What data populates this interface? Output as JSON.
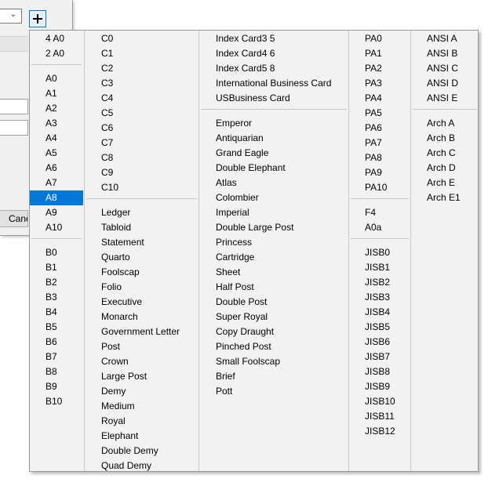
{
  "dialog": {
    "cancel_label": "Cancel"
  },
  "menu": {
    "selected": "A8",
    "columns": [
      {
        "groups": [
          [
            "4 A0",
            "2 A0"
          ],
          [
            "A0",
            "A1",
            "A2",
            "A3",
            "A4",
            "A5",
            "A6",
            "A7",
            "A8",
            "A9",
            "A10"
          ],
          [
            "B0",
            "B1",
            "B2",
            "B3",
            "B4",
            "B5",
            "B6",
            "B7",
            "B8",
            "B9",
            "B10"
          ]
        ]
      },
      {
        "groups": [
          [
            "C0",
            "C1",
            "C2",
            "C3",
            "C4",
            "C5",
            "C6",
            "C7",
            "C8",
            "C9",
            "C10"
          ],
          [
            "Ledger",
            "Tabloid",
            "Statement",
            "Quarto",
            "Foolscap",
            "Folio",
            "Executive",
            "Monarch",
            "Government Letter",
            "Post",
            "Crown",
            "Large Post",
            "Demy",
            "Medium",
            "Royal",
            "Elephant",
            "Double Demy",
            "Quad Demy"
          ]
        ]
      },
      {
        "groups": [
          [
            "Index Card3 5",
            "Index Card4 6",
            "Index Card5 8",
            "International Business Card",
            "USBusiness Card"
          ],
          [
            "Emperor",
            "Antiquarian",
            "Grand Eagle",
            "Double Elephant",
            "Atlas",
            "Colombier",
            "Imperial",
            "Double Large Post",
            "Princess",
            "Cartridge",
            "Sheet",
            "Half Post",
            "Double Post",
            "Super Royal",
            "Copy Draught",
            "Pinched Post",
            "Small Foolscap",
            "Brief",
            "Pott"
          ]
        ]
      },
      {
        "groups": [
          [
            "PA0",
            "PA1",
            "PA2",
            "PA3",
            "PA4",
            "PA5",
            "PA6",
            "PA7",
            "PA8",
            "PA9",
            "PA10"
          ],
          [
            "F4",
            "A0a"
          ],
          [
            "JISB0",
            "JISB1",
            "JISB2",
            "JISB3",
            "JISB4",
            "JISB5",
            "JISB6",
            "JISB7",
            "JISB8",
            "JISB9",
            "JISB10",
            "JISB11",
            "JISB12"
          ]
        ]
      },
      {
        "groups": [
          [
            "ANSI A",
            "ANSI B",
            "ANSI C",
            "ANSI D",
            "ANSI E"
          ],
          [
            "Arch A",
            "Arch B",
            "Arch C",
            "Arch D",
            "Arch E",
            "Arch E1"
          ]
        ]
      }
    ]
  },
  "icons": {
    "add_button": "plus-icon",
    "combo_arrow": "chevron-down-icon"
  }
}
